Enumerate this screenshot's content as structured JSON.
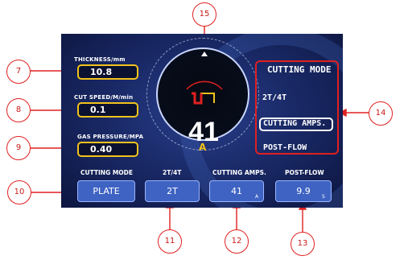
{
  "left_panel": {
    "thickness": {
      "label": "THICKNESS/mm",
      "value": "10.8"
    },
    "cut_speed": {
      "label": "CUT SPEED/M/min",
      "value": "0.1"
    },
    "gas_pressure": {
      "label": "GAS PRESSURE/MPA",
      "value": "0.40"
    }
  },
  "gauge": {
    "value": "41",
    "unit": "A"
  },
  "side_menu": {
    "title": "CUTTING MODE",
    "item_2t4t": "2T/4T",
    "item_cutting_amps": "CUTTING AMPS.",
    "item_post_flow": "POST-FLOW",
    "selected": "CUTTING AMPS."
  },
  "bottom_bar": {
    "cutting_mode": {
      "label": "CUTTING MODE",
      "value": "PLATE"
    },
    "trigger": {
      "label": "2T/4T",
      "value": "2T"
    },
    "cutting_amps": {
      "label": "CUTTING AMPS.",
      "value": "41",
      "unit": "A"
    },
    "post_flow": {
      "label": "POST-FLOW",
      "value": "9.9",
      "unit": "S"
    }
  },
  "callouts": [
    "7",
    "8",
    "9",
    "10",
    "11",
    "12",
    "13",
    "14",
    "15"
  ],
  "colors": {
    "accent_yellow": "#f2c31a",
    "callout_red": "#e02020",
    "screen_blue": "#1a2a68",
    "button_blue": "#3e63c2"
  }
}
